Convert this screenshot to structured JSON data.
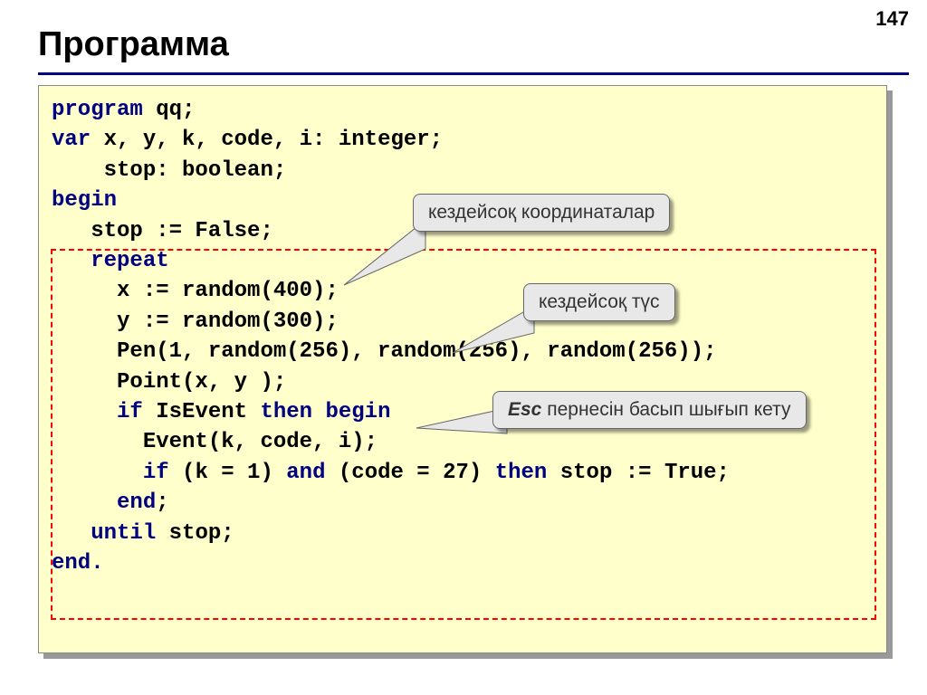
{
  "page_number": "147",
  "title": "Программа",
  "code": {
    "l1a": "program",
    "l1b": " qq;",
    "l2a": "var",
    "l2b": " x, y, k, code, i: integer;",
    "l3": "    stop: boolean;",
    "l4": "begin",
    "l5": "   stop := False;",
    "l6": "   repeat",
    "l7": "     x := random(400);",
    "l8": "     y := random(300);",
    "l9": "     Pen(1, random(256), random(256), random(256));",
    "l10": "     Point(x, y );",
    "l11a": "     ",
    "l11b": "if",
    "l11c": " IsEvent ",
    "l11d": "then begin",
    "l12": "       Event(k, code, i);",
    "l13a": "       ",
    "l13b": "if",
    "l13c": " (k = 1) ",
    "l13d": "and",
    "l13e": " (code = 27) ",
    "l13f": "then",
    "l13g": " stop := True;",
    "l14a": "     ",
    "l14b": "end",
    "l14c": ";",
    "l15a": "   ",
    "l15b": "until",
    "l15c": " stop;",
    "l16": "end."
  },
  "callouts": {
    "coords": "кездейсоқ координаталар",
    "color": "кездейсоқ түс",
    "esc_prefix": "Esc",
    "esc_rest": " пернесін басып шығып кету"
  }
}
